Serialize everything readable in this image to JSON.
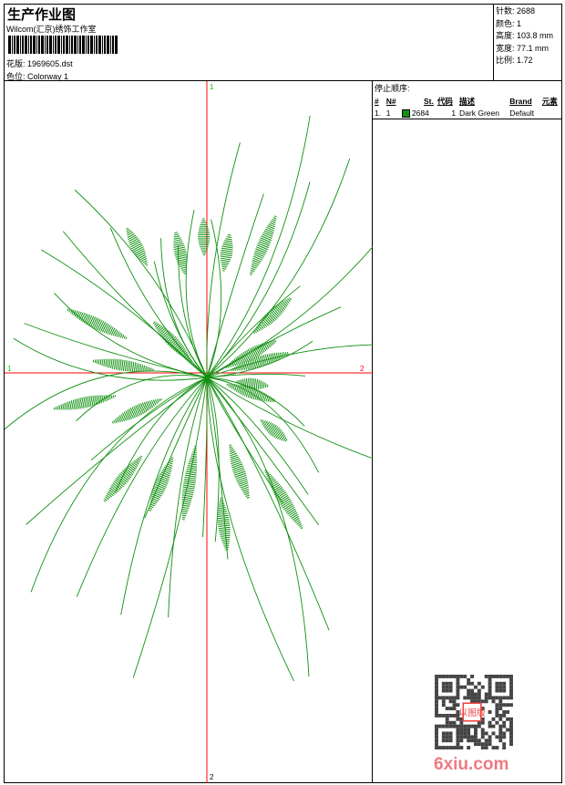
{
  "header": {
    "title": "生产作业图",
    "company": "Wilcom(汇京)绣饰工作室",
    "design_label": "花版:",
    "design_file": "1969605.dst",
    "colorway_label": "色位:",
    "colorway": "Colorway 1"
  },
  "info": {
    "stitches": "针数: 2688",
    "colors": "颜色: 1",
    "height": "高度: 103.8 mm",
    "width": "宽度: 77.1 mm",
    "scale": "比例: 1.72"
  },
  "axes": {
    "top": "1",
    "bottom": "2",
    "left": "1",
    "right": "2",
    "axis_color": "#ff0000",
    "label_green": "#00cc00",
    "label_red": "#ff0000"
  },
  "stop_sequence": {
    "title": "停止顺序:",
    "columns": [
      "#",
      "N#",
      "St.",
      "代码",
      "描述",
      "Brand",
      "元素"
    ],
    "rows": [
      {
        "index": "1.",
        "n": "1",
        "stitches": "2684",
        "code": "1",
        "desc": "Dark Green",
        "brand": "Default",
        "color": "#109010"
      }
    ]
  },
  "watermark": {
    "text": "6xiu.com",
    "seal": "以图版"
  },
  "design_color": "#109010"
}
